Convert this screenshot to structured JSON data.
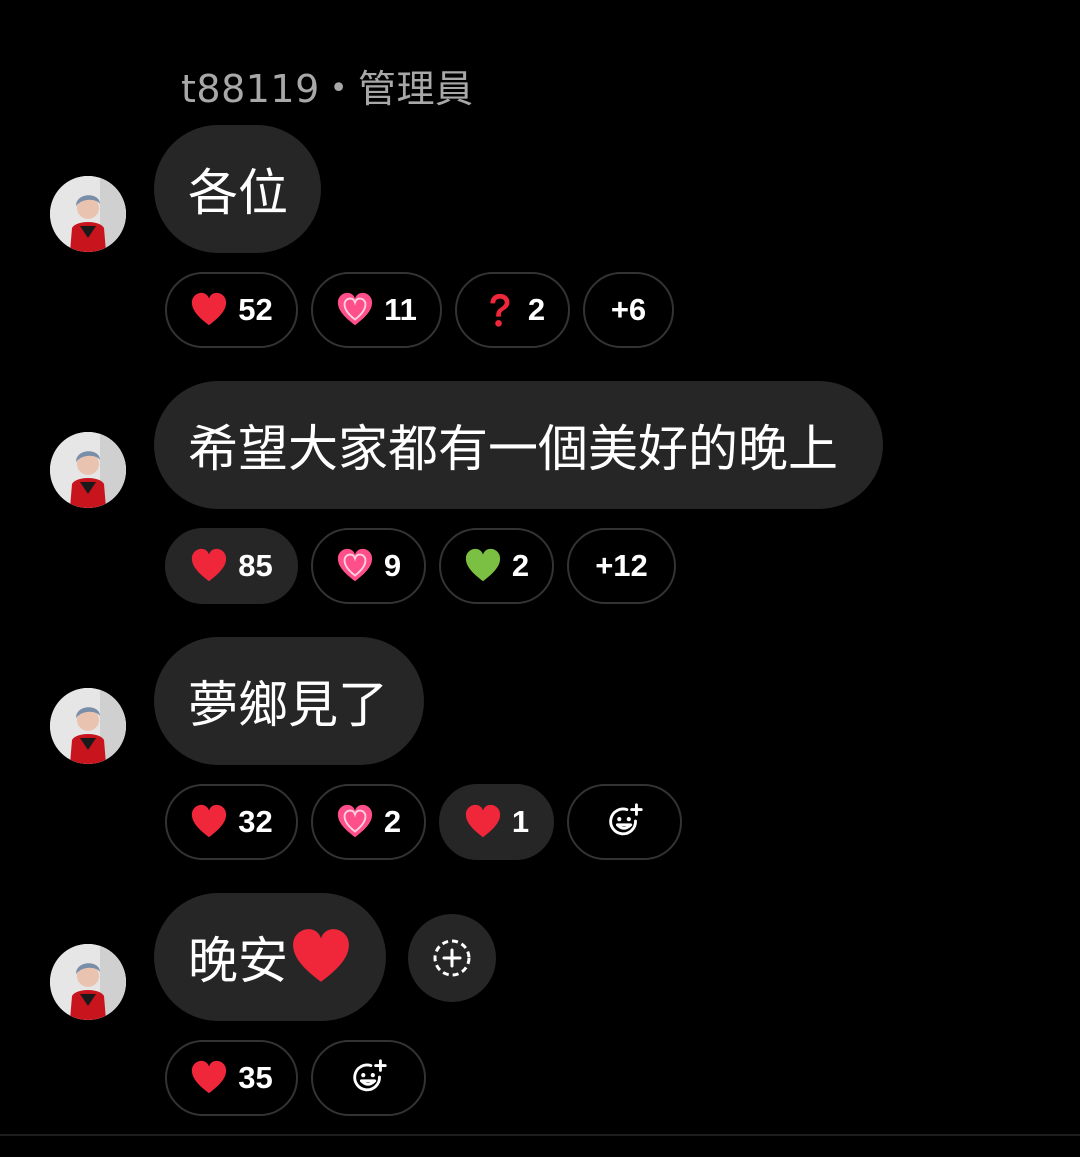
{
  "sender": {
    "username": "t88119",
    "separator": "•",
    "role": "管理員"
  },
  "messages": [
    {
      "text": "各位",
      "reactions": [
        {
          "emoji": "red-heart",
          "count": "52"
        },
        {
          "emoji": "sparkling-heart",
          "count": "11"
        },
        {
          "emoji": "question-mark",
          "count": "2"
        },
        {
          "emoji": "",
          "count": "+6"
        }
      ]
    },
    {
      "text": "希望大家都有一個美好的晚上",
      "reactions": [
        {
          "emoji": "red-heart",
          "count": "85",
          "selected": true
        },
        {
          "emoji": "sparkling-heart",
          "count": "9"
        },
        {
          "emoji": "green-heart",
          "count": "2"
        },
        {
          "emoji": "",
          "count": "+12"
        }
      ]
    },
    {
      "text": "夢鄉見了",
      "reactions": [
        {
          "emoji": "red-heart",
          "count": "32"
        },
        {
          "emoji": "sparkling-heart",
          "count": "2"
        },
        {
          "emoji": "red-heart",
          "count": "1",
          "selected": true
        },
        {
          "emoji": "add-emoji-icon",
          "count": ""
        }
      ]
    },
    {
      "text": "晚安",
      "trailing_emoji": "red-heart",
      "reactions": [
        {
          "emoji": "red-heart",
          "count": "35"
        },
        {
          "emoji": "add-emoji-icon",
          "count": ""
        }
      ]
    }
  ],
  "colors": {
    "background": "#000000",
    "bubble": "#262626",
    "chip_border": "#333333",
    "muted_text": "#a8a8a8",
    "heart_red": "#f0263a",
    "heart_pink": "#ff4f8b",
    "heart_green": "#7bc043"
  }
}
